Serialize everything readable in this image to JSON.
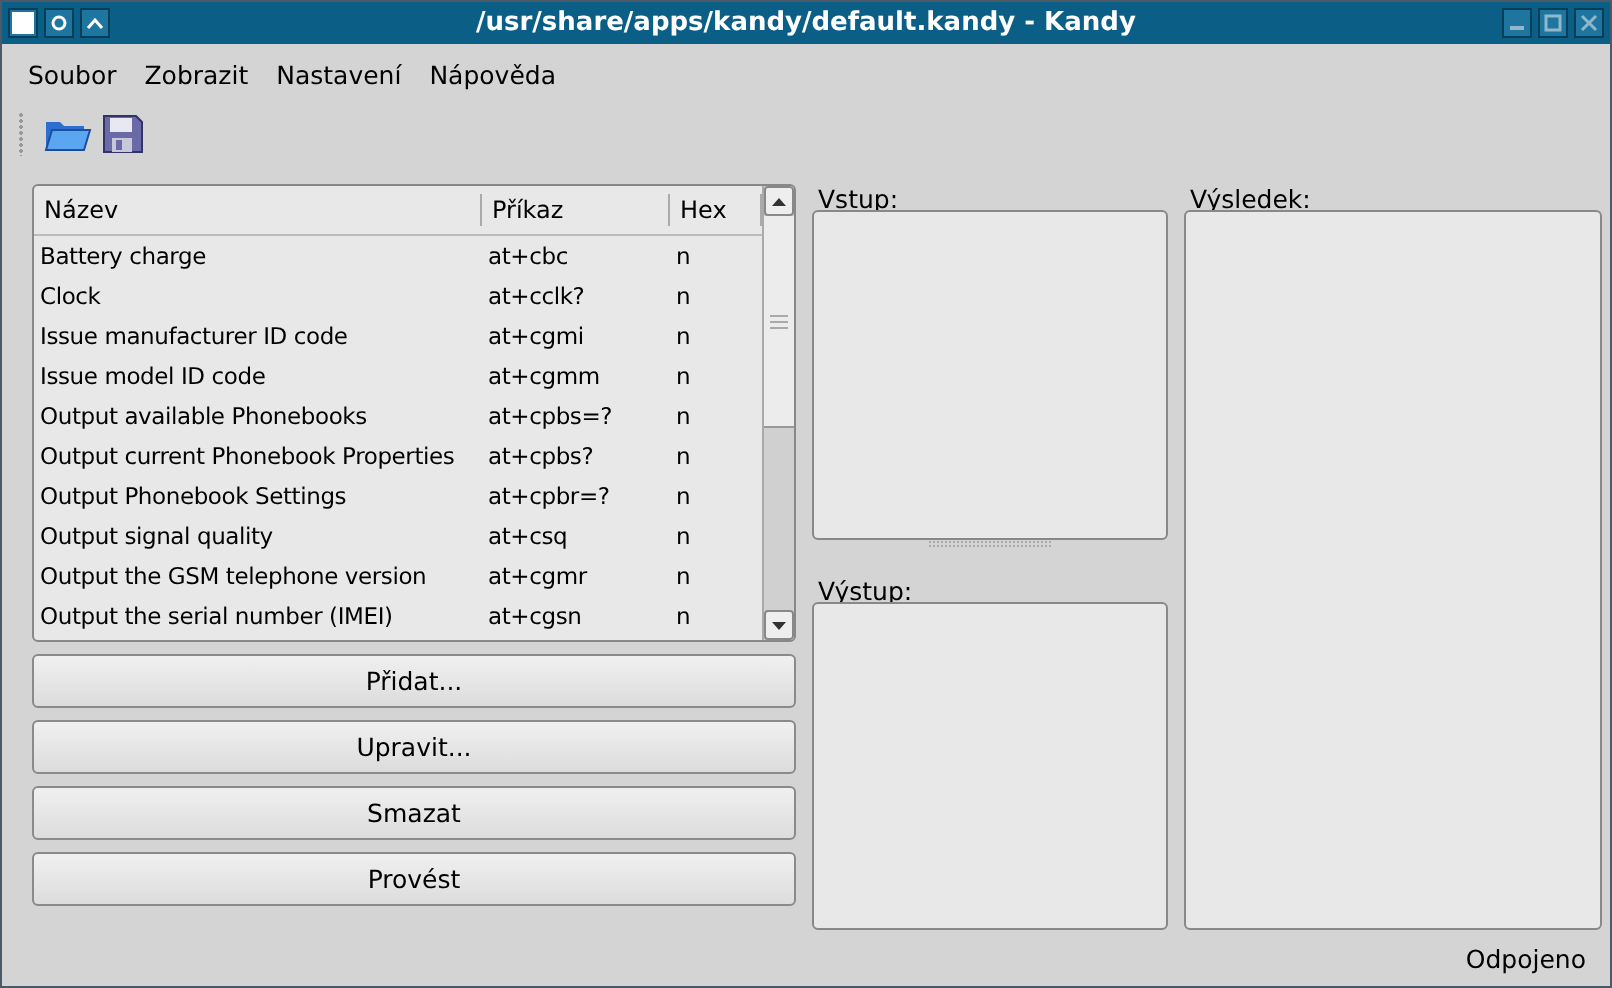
{
  "window": {
    "title": "/usr/share/apps/kandy/default.kandy - Kandy"
  },
  "menu": [
    "Soubor",
    "Zobrazit",
    "Nastavení",
    "Nápověda"
  ],
  "table": {
    "columns": [
      "Název",
      "Příkaz",
      "Hex"
    ],
    "rows": [
      {
        "name": "Battery charge",
        "command": "at+cbc",
        "hex": "n"
      },
      {
        "name": "Clock",
        "command": "at+cclk?",
        "hex": "n"
      },
      {
        "name": "Issue manufacturer ID code",
        "command": "at+cgmi",
        "hex": "n"
      },
      {
        "name": "Issue model ID code",
        "command": "at+cgmm",
        "hex": "n"
      },
      {
        "name": "Output available Phonebooks",
        "command": "at+cpbs=?",
        "hex": "n"
      },
      {
        "name": "Output current Phonebook Properties",
        "command": "at+cpbs?",
        "hex": "n"
      },
      {
        "name": "Output Phonebook Settings",
        "command": "at+cpbr=?",
        "hex": "n"
      },
      {
        "name": "Output signal quality",
        "command": "at+csq",
        "hex": "n"
      },
      {
        "name": "Output the GSM telephone version",
        "command": "at+cgmr",
        "hex": "n"
      },
      {
        "name": "Output the serial number (IMEI)",
        "command": "at+cgsn",
        "hex": "n"
      }
    ]
  },
  "buttons": [
    "Přidat...",
    "Upravit...",
    "Smazat",
    "Provést"
  ],
  "input_label": "Vstup:",
  "output_label": "Výstup:",
  "result_label": "Výsledek:",
  "status_bar": "Odpojeno"
}
